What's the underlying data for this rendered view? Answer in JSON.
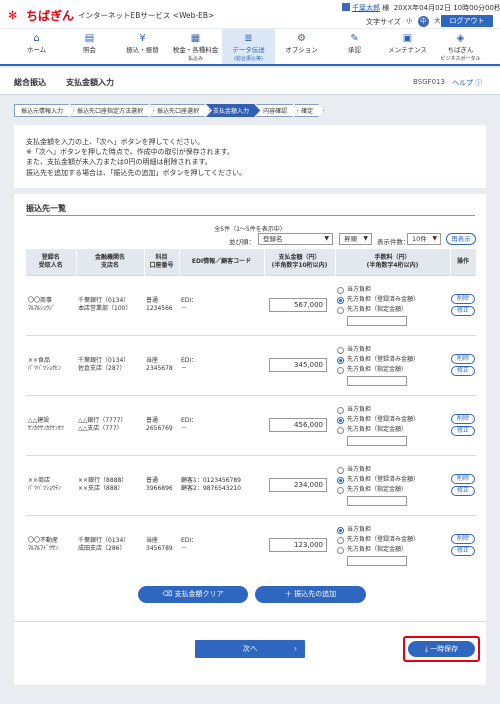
{
  "header": {
    "logo_text": "ちばぎん",
    "service_name": "インターネットEBサービス <Web-EB>",
    "user_name": "千葉太郎",
    "user_suffix": "様",
    "datetime": "20XX年04月02日 10時00分00秒",
    "font_size_label": "文字サイズ",
    "font_small": "小",
    "font_medium": "中",
    "font_large": "大",
    "logout_label": "ログアウト"
  },
  "menu": [
    {
      "label": "ホーム",
      "sub": "",
      "icon": "home-icon",
      "glyph": "⌂"
    },
    {
      "label": "照会",
      "sub": "",
      "icon": "document-icon",
      "glyph": "▤"
    },
    {
      "label": "振込・振替",
      "sub": "",
      "icon": "yen-icon",
      "glyph": "¥"
    },
    {
      "label": "税金・各種料金",
      "sub": "払込み",
      "icon": "tax-icon",
      "glyph": "▦"
    },
    {
      "label": "データ伝送",
      "sub": "(総合振込等)",
      "icon": "database-icon",
      "glyph": "≣"
    },
    {
      "label": "オプション",
      "sub": "",
      "icon": "gear-icon",
      "glyph": "⚙"
    },
    {
      "label": "承認",
      "sub": "",
      "icon": "approve-icon",
      "glyph": "✎"
    },
    {
      "label": "メンテナンス",
      "sub": "",
      "icon": "maintenance-icon",
      "glyph": "▣"
    },
    {
      "label": "ちばぎん",
      "sub": "ビジネスポータル",
      "icon": "portal-icon",
      "glyph": "◈"
    }
  ],
  "breadcrumb": {
    "title": "総合振込",
    "subtitle": "支払金額入力",
    "screen_code": "BSGF013",
    "help": "ヘルプ"
  },
  "steps": [
    "振込元情報入力",
    "振込先口座指定方法選択",
    "振込先口座選択",
    "支払金額入力",
    "内容確認",
    "確定"
  ],
  "notes": [
    "支払金額を入力の上、「次へ」ボタンを押してください。",
    "※「次へ」ボタンを押した時点で、作成中の取引が保存されます。",
    "また、支払金額が未入力または0円の明細は削除されます。",
    "振込先を追加する場合は、「振込先の追加」ボタンを押してください。"
  ],
  "list": {
    "section_title": "振込先一覧",
    "count_text": "全5件（1～5件を表示中）",
    "sort_label": "並び順：",
    "sort_value": "登録名",
    "order_value": "昇順",
    "per_page_label": "表示件数：",
    "per_page_value": "10件",
    "redisplay": "再表示"
  },
  "table_headers": {
    "name": "登録名\n受取人名",
    "bank": "金融機関名\n支店名",
    "account": "科目\n口座番号",
    "edi": "EDI情報／顧客コード",
    "amount": "支払金額（円）\n(半角数字10桁以内)",
    "fee": "手数料（円）\n(半角数字4桁以内)",
    "ops": "操作"
  },
  "fee_options": [
    "当方負担",
    "先方負担（登録済み金額）",
    "先方負担（指定金額）"
  ],
  "rows": [
    {
      "name": "〇〇商事",
      "kana": "ﾏﾙﾏﾙｼｮｳｼﾞ",
      "bank": "千葉銀行（0134）",
      "branch": "本店営業部（100）",
      "type": "普通",
      "acct": "1234566",
      "edi": "EDI：",
      "edi2": "－",
      "amount": "567,000",
      "fee_sel": 1
    },
    {
      "name": "××食品",
      "kana": "ﾊﾞﾂﾊﾞﾂｼｮｸﾋﾝ",
      "bank": "千葉銀行（0134）",
      "branch": "佐倉支店（287）",
      "type": "当座",
      "acct": "2345678",
      "edi": "EDI：",
      "edi2": "－",
      "amount": "345,000",
      "fee_sel": 1
    },
    {
      "name": "△△建設",
      "kana": "ｻﾝｶｸｻﾝｶｸｹﾝｾﾂ",
      "bank": "△△銀行（7777）",
      "branch": "△△支店（777）",
      "type": "普通",
      "acct": "2656769",
      "edi": "EDI：",
      "edi2": "－",
      "amount": "456,000",
      "fee_sel": 1
    },
    {
      "name": "××商店",
      "kana": "ﾊﾞﾂﾊﾞﾂｼｮｳﾃﾝ",
      "bank": "××銀行（8888）",
      "branch": "××支店（888）",
      "type": "普通",
      "acct": "3966896",
      "edi": "顧客1：0123456789",
      "edi2": "顧客2：9876543210",
      "amount": "234,000",
      "fee_sel": 1
    },
    {
      "name": "〇〇不動産",
      "kana": "ﾏﾙﾏﾙﾌﾄﾞｳｻﾝ",
      "bank": "千葉銀行（0134）",
      "branch": "成田支店（286）",
      "type": "当座",
      "acct": "3456789",
      "edi": "EDI：",
      "edi2": "－",
      "amount": "123,000",
      "fee_sel": 0
    }
  ],
  "row_buttons": {
    "delete": "削除",
    "edit": "修正"
  },
  "buttons": {
    "clear": "支払金額クリア",
    "add": "振込先の追加",
    "next": "次へ",
    "save": "一時保存"
  }
}
